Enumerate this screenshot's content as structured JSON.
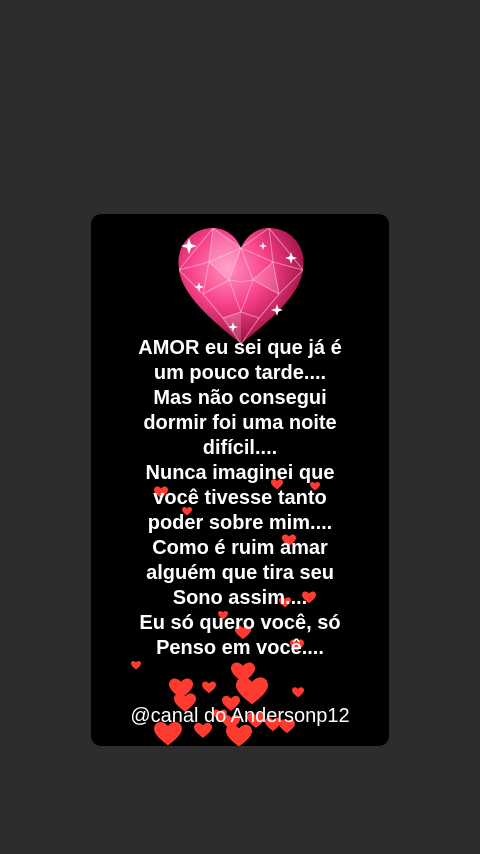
{
  "poem_lines": [
    "AMOR eu sei que já é",
    "um pouco tarde....",
    "Mas não consegui",
    "dormir foi uma noite",
    "difícil....",
    "Nunca imaginei que",
    "você tivesse tanto",
    "poder sobre mim....",
    "Como é ruim amar",
    "alguém que tira seu",
    "Sono assim....",
    "Eu só quero você, só",
    "Penso em você...."
  ],
  "channel_label": "@canal do Andersonp12",
  "icons": {
    "main": "diamond-heart-icon",
    "decor": "floating-hearts"
  },
  "colors": {
    "page_bg": "#2d2d2d",
    "card_bg": "#000000",
    "text": "#ffffff",
    "gem_light": "#f7418a",
    "gem_dark": "#a3083f",
    "heart_red": "#ff3b30"
  }
}
